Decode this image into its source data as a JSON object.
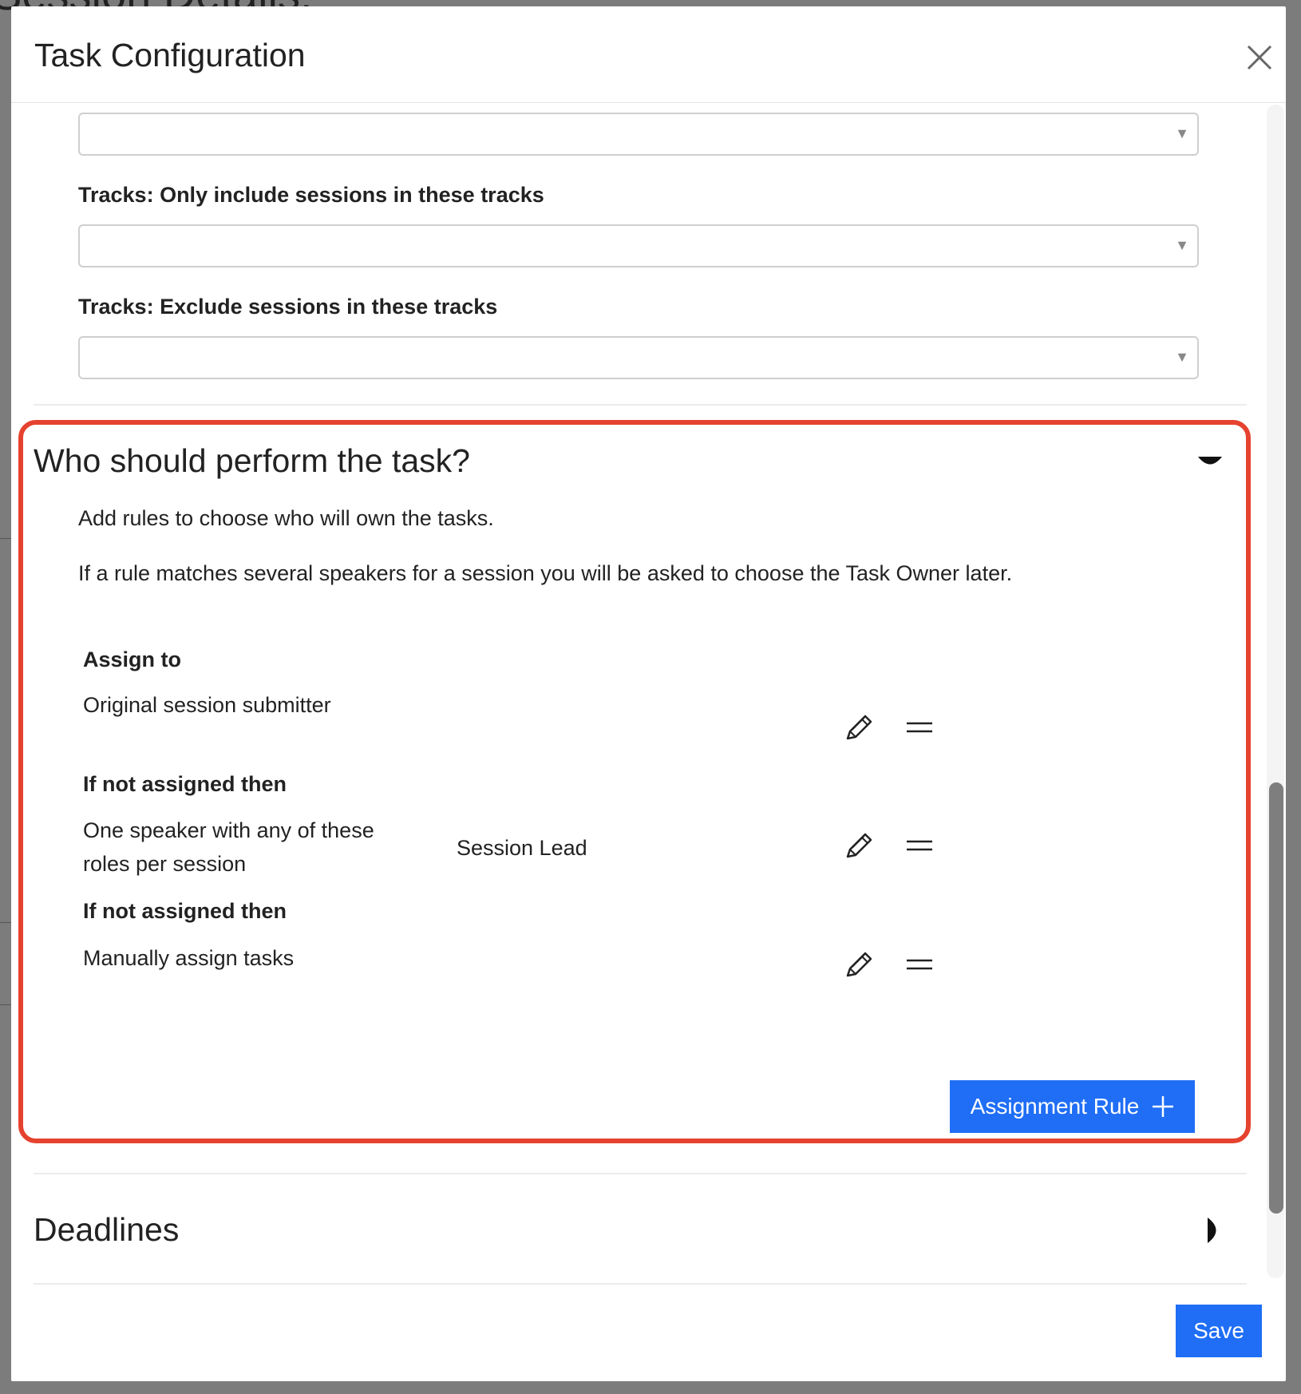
{
  "background": {
    "page_title": "Session Details:"
  },
  "modal": {
    "title": "Task Configuration",
    "close_icon": "close-icon"
  },
  "filters": {
    "track_include_label": "Tracks: Only include sessions in these tracks",
    "track_exclude_label": "Tracks: Exclude sessions in these tracks",
    "caret": "▼"
  },
  "assign_section": {
    "title": "Who should perform the task?",
    "description_1": "Add rules to choose who will own the tasks.",
    "description_2": "If a rule matches several speakers for a session you will be asked to choose the Task Owner later.",
    "rules": [
      {
        "heading": "Assign to",
        "text": "Original session submitter",
        "detail": ""
      },
      {
        "heading": "If not assigned then",
        "text": "One speaker with any of these roles per session",
        "detail": "Session Lead"
      },
      {
        "heading": "If not assigned then",
        "text": "Manually assign tasks",
        "detail": ""
      }
    ],
    "add_rule_label": "Assignment Rule"
  },
  "deadlines_section": {
    "title": "Deadlines"
  },
  "footer": {
    "save_label": "Save"
  },
  "colors": {
    "accent": "#1f6ef5",
    "highlight_border": "#e5432f"
  }
}
